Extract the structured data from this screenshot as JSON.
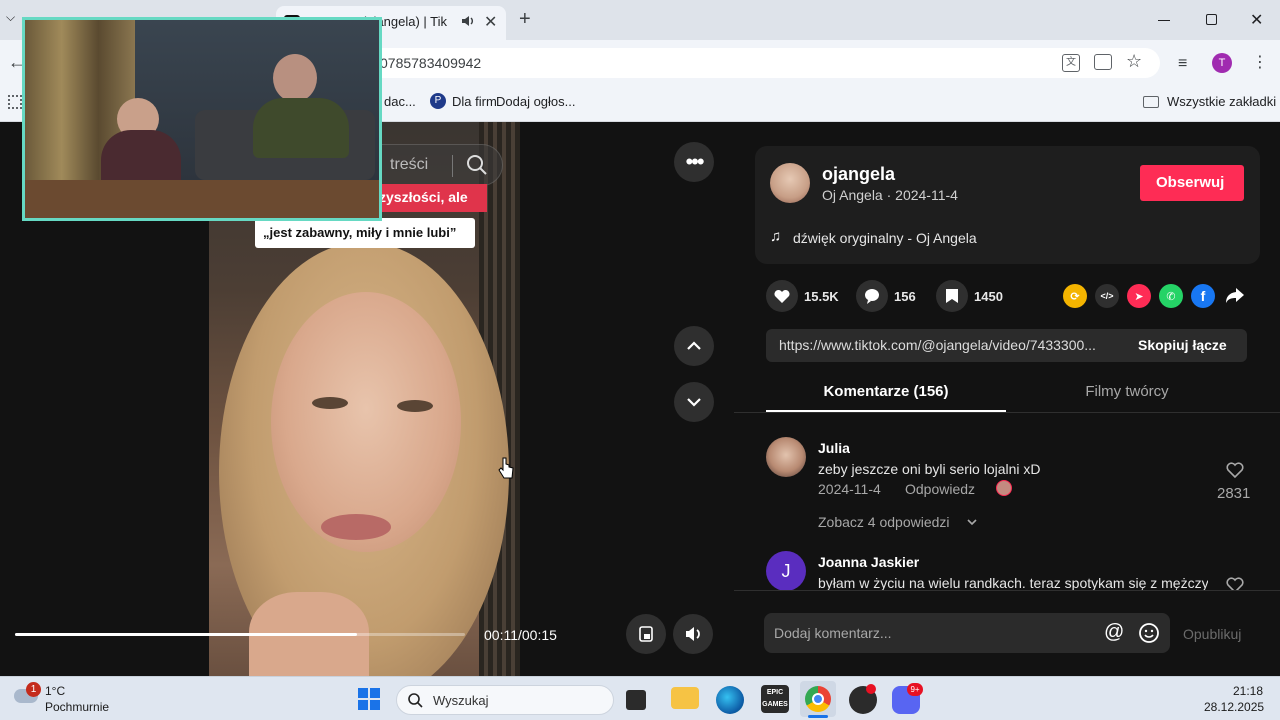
{
  "browser": {
    "tab_title": "(ojangela) | Tik",
    "url_partial": "0785783409942",
    "bookmarks": [
      {
        "label": "dac..."
      },
      {
        "label": "Dla firm"
      },
      {
        "label": "Dodaj ogłos..."
      }
    ],
    "all_bookmarks_label": "Wszystkie zakładki",
    "profile_initial": "T"
  },
  "video": {
    "search_placeholder": "treści",
    "caption_line1": "zyszłości, ale",
    "caption_line2": "„jest zabawny, miły i mnie lubi”",
    "time": "00:11/00:15",
    "progress": 0.76
  },
  "post": {
    "username": "ojangela",
    "meta": "Oj Angela · 2024-11-4",
    "follow_label": "Obserwuj",
    "sound": "dźwięk oryginalny - Oj Angela",
    "likes": "15.5K",
    "comments": "156",
    "saves": "1450",
    "link": "https://www.tiktok.com/@ojangela/video/7433300...",
    "copy_label": "Skopiuj łącze"
  },
  "tabs": [
    {
      "label": "Komentarze (156)",
      "active": true
    },
    {
      "label": "Filmy twórcy",
      "active": false
    }
  ],
  "comments": [
    {
      "author": "Julia",
      "text": "zeby jeszcze oni byli serio lojalni xD",
      "date": "2024-11-4",
      "reply_label": "Odpowiedz",
      "likes": "2831",
      "see_replies": "Zobacz 4 odpowiedzi"
    },
    {
      "author": "Joanna Jaskier",
      "avatar_initial": "J",
      "text": "byłam w życiu na wielu randkach. teraz spotykam się z mężczyzną"
    }
  ],
  "composer": {
    "placeholder": "Dodaj komentarz...",
    "publish_label": "Opublikuj"
  },
  "taskbar": {
    "weather_temp": "1°C",
    "weather_desc": "Pochmurnie",
    "weather_badge": "1",
    "search_placeholder": "Wyszukaj",
    "time": "21:18",
    "date": "28.12.2025",
    "epic_label": "EPIC GAMES",
    "discord_badge": "9+"
  },
  "colors": {
    "accent": "#fe2c55",
    "pip_border": "#66d9c3",
    "tab_underline": "#ffffff"
  }
}
